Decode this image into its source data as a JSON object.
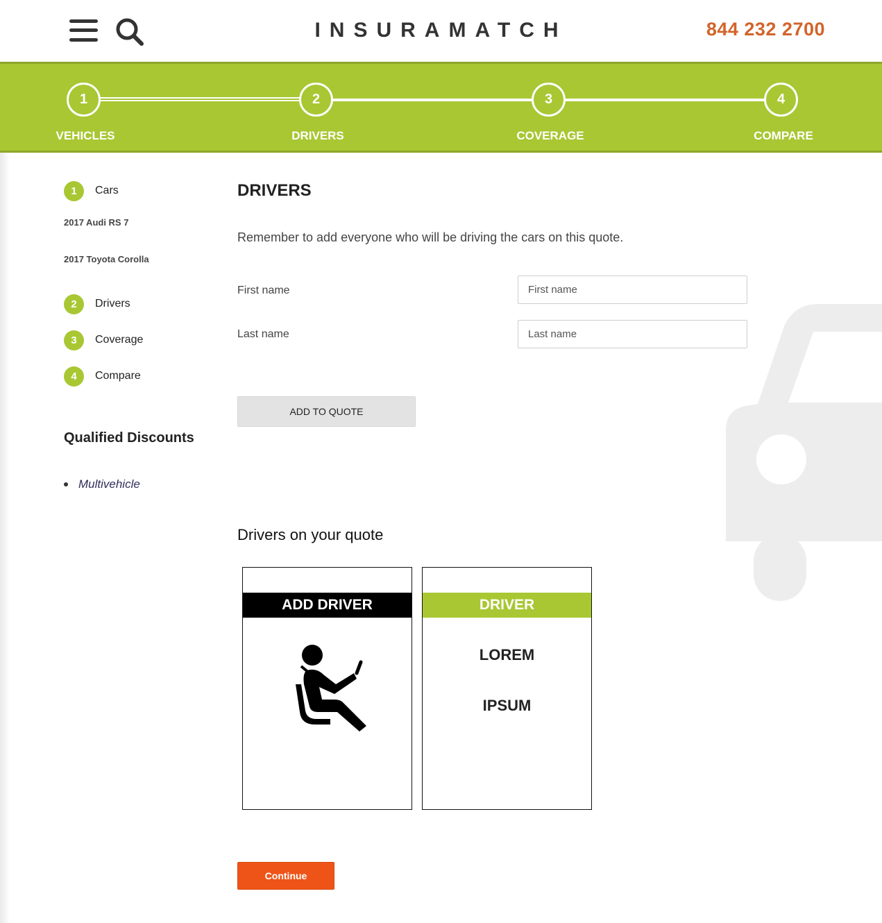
{
  "header": {
    "brand": "INSURAMATCH",
    "phone": "844 232 2700"
  },
  "progress": {
    "steps": [
      {
        "number": "1",
        "label": "VEHICLES"
      },
      {
        "number": "2",
        "label": "DRIVERS"
      },
      {
        "number": "3",
        "label": "COVERAGE"
      },
      {
        "number": "4",
        "label": "COMPARE"
      }
    ],
    "current_step": 2
  },
  "sidebar": {
    "steps": [
      {
        "number": "1",
        "label": "Cars"
      },
      {
        "number": "2",
        "label": "Drivers"
      },
      {
        "number": "3",
        "label": "Coverage"
      },
      {
        "number": "4",
        "label": "Compare"
      }
    ],
    "cars": [
      "2017 Audi RS 7",
      "2017 Toyota Corolla"
    ],
    "discounts_title": "Qualified Discounts",
    "discounts": [
      "Multivehicle"
    ]
  },
  "main": {
    "title": "DRIVERS",
    "intro": "Remember to add everyone who will be driving the cars on this quote.",
    "first_name_label": "First name",
    "first_name_placeholder": "First name",
    "first_name_value": "",
    "last_name_label": "Last name",
    "last_name_placeholder": "Last name",
    "last_name_value": "",
    "add_button": "ADD TO QUOTE",
    "drivers_heading": "Drivers on your quote",
    "add_driver_card": {
      "title": "ADD DRIVER",
      "icon": "seated-driver-icon"
    },
    "driver_card": {
      "title": "DRIVER",
      "line1": "LOREM",
      "line2": "IPSUM"
    },
    "continue_button": "Continue"
  },
  "colors": {
    "accent_green": "#a8c733",
    "phone_orange": "#d2642a",
    "continue_orange": "#ee5418"
  }
}
